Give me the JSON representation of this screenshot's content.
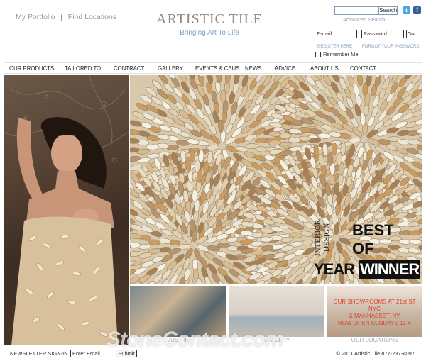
{
  "header": {
    "links": [
      "My Portfolio",
      "Find Locations"
    ],
    "brand_title": "ARTISTIC TILE",
    "brand_tagline": "Bringing Art To Life",
    "search_button": "Search",
    "advanced_search": "Advanced Search",
    "twitter_icon": "twitter-icon",
    "facebook_icon": "facebook-icon"
  },
  "login": {
    "email_placeholder": "E-mail",
    "password_placeholder": "Password",
    "go_label": "Go",
    "register_label": "REGISTER HERE",
    "forgot_label": "FORGOT YOUR PASSWORD",
    "remember_label": "Remember Me"
  },
  "nav": {
    "items": [
      "OUR PRODUCTS",
      "TAILORED TO",
      "CONTRACT",
      "GALLERY",
      "EVENTS & CEUS",
      "NEWS",
      "ADVICE",
      "ABOUT US",
      "CONTACT"
    ]
  },
  "award": {
    "interior": "INTERIOR DESIGN",
    "best": "BEST",
    "of": "OF",
    "year": "YEAR",
    "winner": "WINNER"
  },
  "promos": {
    "showroom_lines": [
      "OUR SHOWROOMS AT 21st ST NYC",
      "& MANHASSET, NY",
      "NOW OPEN SUNDAYS 12-4"
    ],
    "captions": [
      "JUST IN",
      "GALLERY",
      "OUR LOCATIONS"
    ]
  },
  "footer": {
    "newsletter_label": "NEWSLETTER SIGN-IN",
    "newsletter_placeholder": "Enter Email",
    "submit_label": "Submit",
    "copyright": "© 2011 Artistic Tile 877-237-4097",
    "watermark": "StoneContact.com"
  },
  "colors": {
    "accent_blue": "#7fa3c4",
    "promo_red": "#d9462d",
    "twitter": "#4fa8d9",
    "facebook": "#3b5d9a"
  }
}
